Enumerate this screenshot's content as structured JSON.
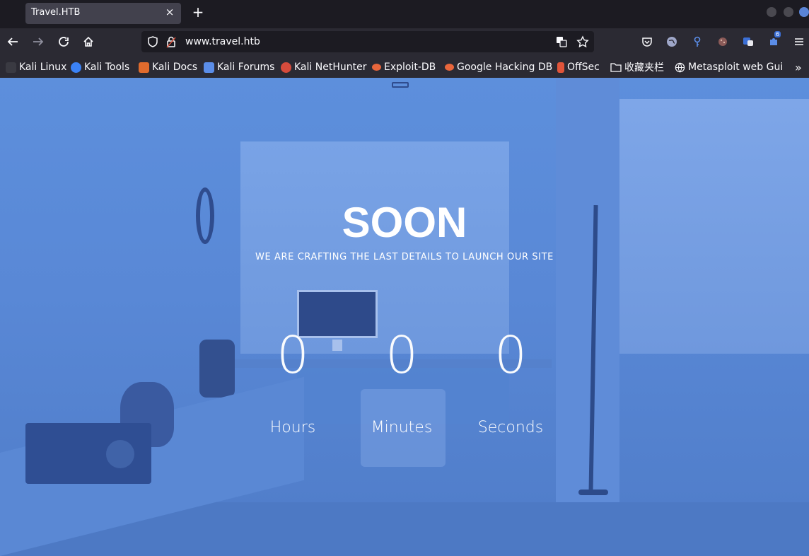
{
  "tab": {
    "title": "Travel.HTB",
    "close": "×",
    "new_tab": "+"
  },
  "address_bar": {
    "url": "www.travel.htb"
  },
  "extensions": {
    "badge": "6"
  },
  "bookmarks": [
    {
      "label": "Kali Linux",
      "color": "#3a3a42"
    },
    {
      "label": "Kali Tools",
      "color": "#3b82f6"
    },
    {
      "label": "Kali Docs",
      "color": "#e06b2d"
    },
    {
      "label": "Kali Forums",
      "color": "#5b8de8"
    },
    {
      "label": "Kali NetHunter",
      "color": "#d64b3c"
    },
    {
      "label": "Exploit-DB",
      "color": "#e8663c"
    },
    {
      "label": "Google Hacking DB",
      "color": "#e8663c"
    },
    {
      "label": "OffSec",
      "color": "#e0543a"
    },
    {
      "label": "收藏夹栏",
      "color": "#fbfbfe"
    },
    {
      "label": "Metasploit web Gui",
      "color": "#fbfbfe"
    }
  ],
  "hero": {
    "title": "SOON",
    "tagline": "WE ARE CRAFTING THE LAST DETAILS TO LAUNCH OUR SITE",
    "countdown": [
      {
        "value": "0",
        "label": "Hours"
      },
      {
        "value": "0",
        "label": "Minutes"
      },
      {
        "value": "0",
        "label": "Seconds"
      }
    ]
  },
  "colors": {
    "overlay": "#5a8ad8",
    "browser_dark": "#1c1b22",
    "toolbar": "#2b2a33"
  }
}
